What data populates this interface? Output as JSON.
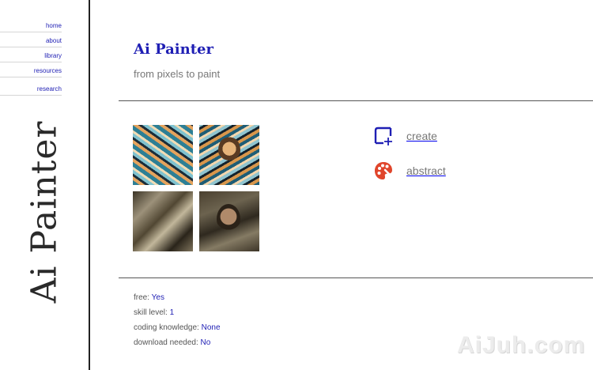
{
  "nav": [
    {
      "label": "home"
    },
    {
      "label": "about"
    },
    {
      "label": "library"
    },
    {
      "label": "resources"
    },
    {
      "label": "research"
    }
  ],
  "sidebar": {
    "vertical_title": "Ai Painter"
  },
  "header": {
    "title": "Ai Painter",
    "subtitle": "from pixels to paint"
  },
  "gallery": [
    {
      "icon": "swirl-pattern"
    },
    {
      "icon": "portrait-swirl"
    },
    {
      "icon": "cubist-figure"
    },
    {
      "icon": "portrait-man"
    }
  ],
  "features": [
    {
      "label": "create",
      "icon": "crop-add-icon",
      "color": "#1f1fb4"
    },
    {
      "label": "abstract",
      "icon": "palette-icon",
      "color": "#e0452b"
    }
  ],
  "facts": [
    {
      "label": "free:",
      "value": "Yes"
    },
    {
      "label": "skill level:",
      "value": "1"
    },
    {
      "label": "coding knowledge:",
      "value": "None"
    },
    {
      "label": "download needed:",
      "value": "No"
    }
  ],
  "watermark": "AiJuh.com",
  "colors": {
    "link": "#1f1fb4",
    "accent": "#e0452b",
    "text": "#555555"
  }
}
